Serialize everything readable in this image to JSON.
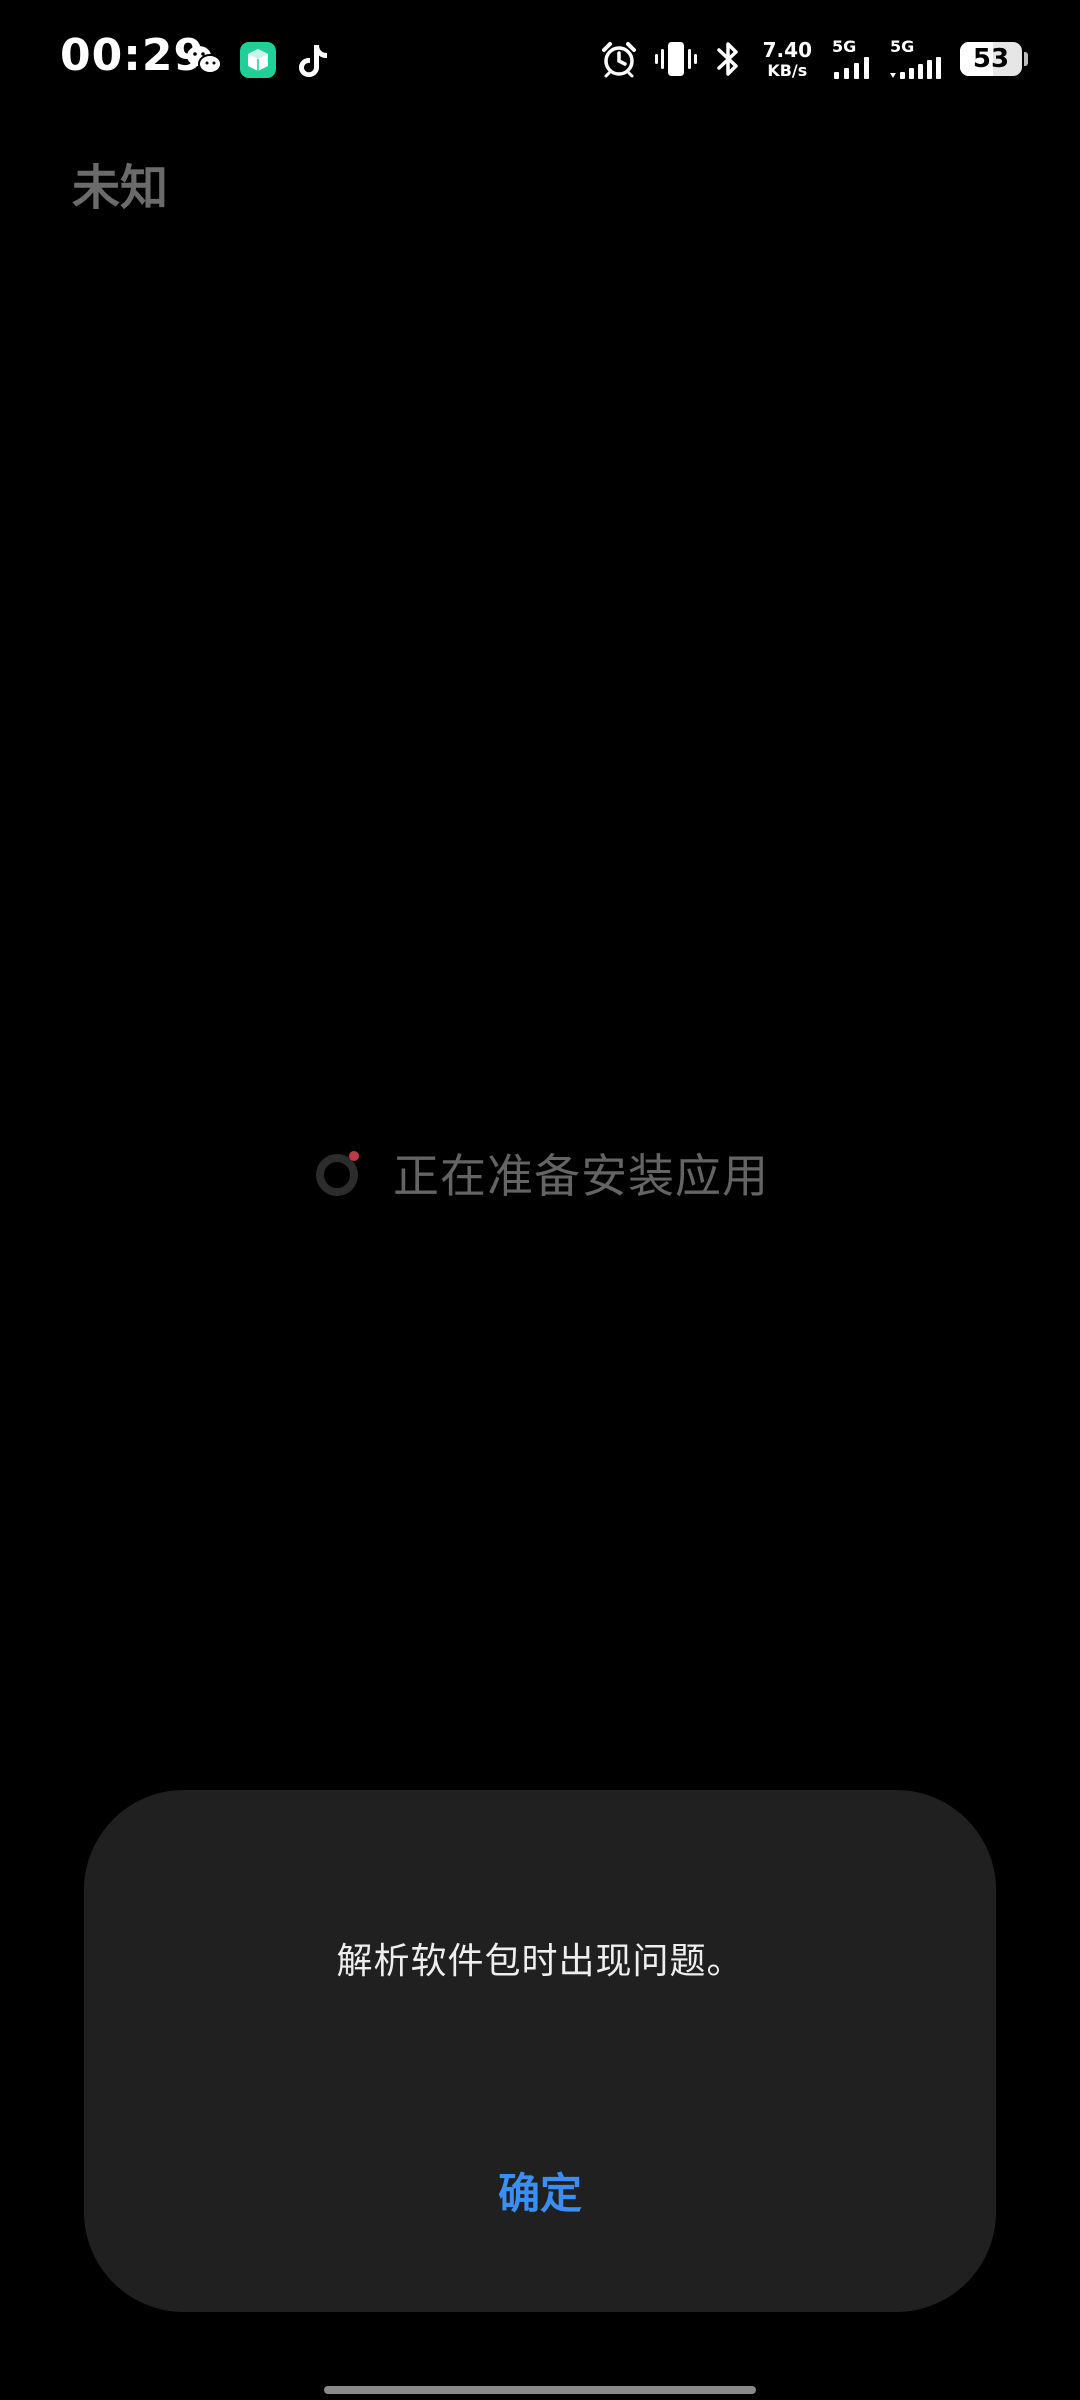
{
  "status_bar": {
    "time": "00:29",
    "notification_icons": [
      "wechat-icon",
      "cube-app-icon",
      "tiktok-icon"
    ],
    "network_speed_value": "7.40",
    "network_speed_unit": "KB/s",
    "sim1_label": "5G",
    "sim2_label": "5G",
    "battery_level": "53",
    "system_icons": [
      "alarm-icon",
      "vibrate-icon",
      "bluetooth-icon"
    ]
  },
  "page": {
    "title": "未知"
  },
  "loading": {
    "text": "正在准备安装应用"
  },
  "dialog": {
    "message": "解析软件包时出现问题。",
    "confirm_label": "确定"
  },
  "colors": {
    "background": "#000000",
    "dialog_background": "#202020",
    "accent": "#3a8ef6",
    "muted_text": "#646464",
    "spinner_dot": "#c0394b"
  }
}
